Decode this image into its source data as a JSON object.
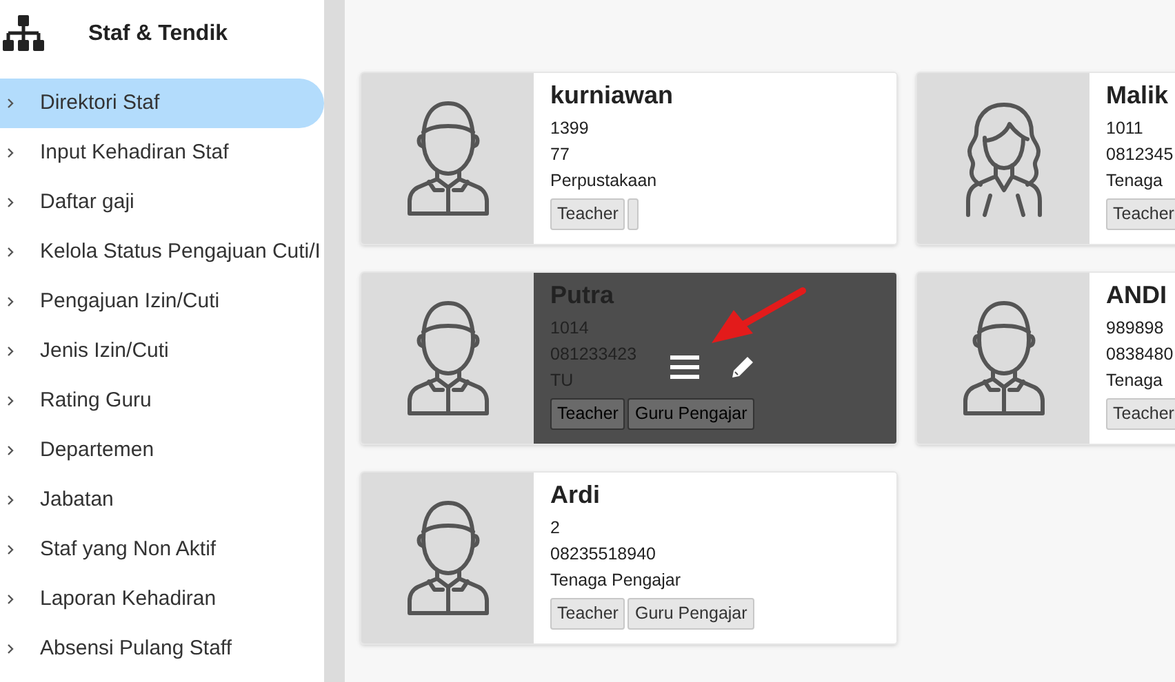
{
  "sidebar": {
    "title": "Staf & Tendik",
    "items": [
      {
        "label": "Direktori Staf",
        "selected": true
      },
      {
        "label": "Input Kehadiran Staf",
        "selected": false
      },
      {
        "label": "Daftar gaji",
        "selected": false
      },
      {
        "label": "Kelola Status Pengajuan Cuti/I",
        "selected": false
      },
      {
        "label": "Pengajuan Izin/Cuti",
        "selected": false
      },
      {
        "label": "Jenis Izin/Cuti",
        "selected": false
      },
      {
        "label": "Rating Guru",
        "selected": false
      },
      {
        "label": "Departemen",
        "selected": false
      },
      {
        "label": "Jabatan",
        "selected": false
      },
      {
        "label": "Staf yang Non Aktif",
        "selected": false
      },
      {
        "label": "Laporan Kehadiran",
        "selected": false
      },
      {
        "label": "Absensi Pulang Staff",
        "selected": false
      }
    ]
  },
  "staff_cards": [
    {
      "name": "kurniawan",
      "lines": [
        "1399",
        "77",
        "Perpustakaan"
      ],
      "tags": [
        "Teacher"
      ],
      "blank_tag": true,
      "kind": "male",
      "hovered": false
    },
    {
      "name": "Malik",
      "lines": [
        "1011",
        "0812345",
        "Tenaga"
      ],
      "tags": [
        "Teacher"
      ],
      "kind": "female",
      "hovered": false
    },
    {
      "name": "Putra",
      "lines": [
        "1014",
        "081233423",
        "TU"
      ],
      "tags": [
        "Teacher",
        "Guru Pengajar"
      ],
      "kind": "male",
      "hovered": true
    },
    {
      "name": "ANDI",
      "lines": [
        "989898",
        "0838480",
        "Tenaga"
      ],
      "tags": [
        "Teacher"
      ],
      "kind": "male",
      "hovered": false
    },
    {
      "name": "Ardi",
      "lines": [
        "2",
        "08235518940",
        "Tenaga Pengajar"
      ],
      "tags": [
        "Teacher",
        "Guru Pengajar"
      ],
      "kind": "male",
      "hovered": false
    }
  ]
}
